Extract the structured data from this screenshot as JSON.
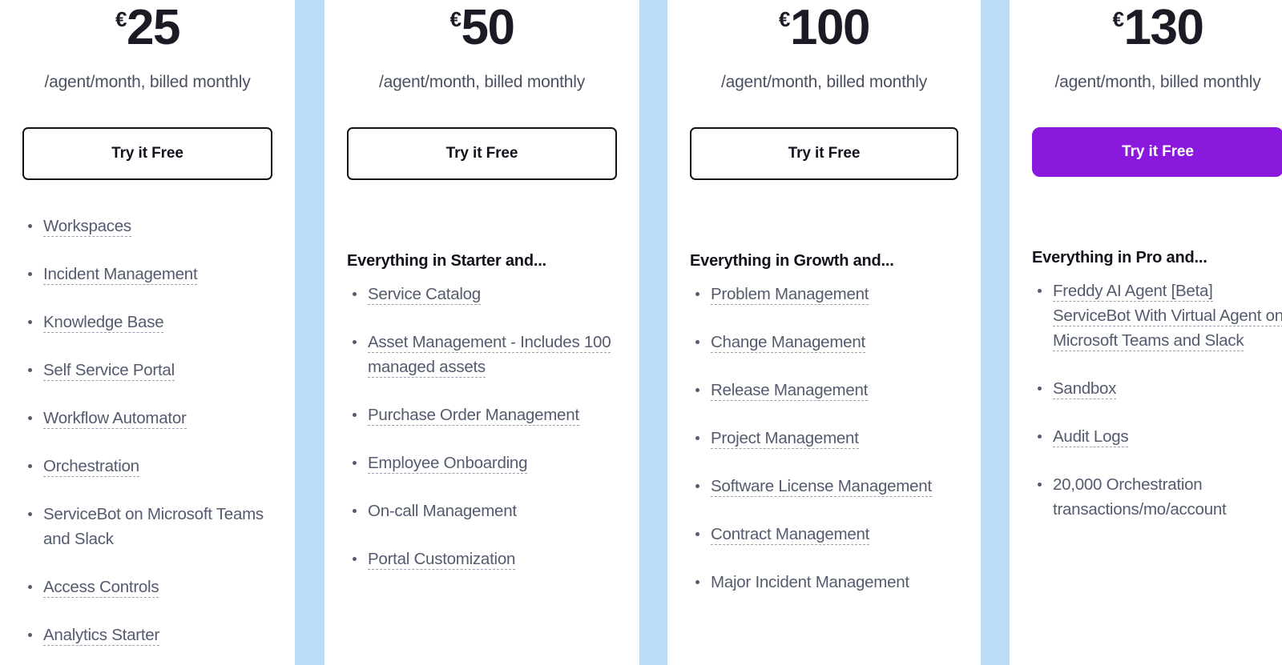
{
  "meta": {
    "accent_purple": "#8b18dd",
    "divider_blue": "#bcdcf5",
    "text_dark": "#12121c",
    "text_muted": "#545b6e"
  },
  "plans": [
    {
      "id": "starter",
      "currency": "€",
      "amount": "25",
      "billing_note": "/agent/month, billed monthly",
      "cta_label": "Try it Free",
      "cta_style": "outline",
      "everything_heading": null,
      "features": [
        {
          "label": "Workspaces",
          "tipped": true
        },
        {
          "label": "Incident Management",
          "tipped": true
        },
        {
          "label": "Knowledge Base",
          "tipped": true
        },
        {
          "label": "Self Service Portal",
          "tipped": true
        },
        {
          "label": "Workflow Automator",
          "tipped": true
        },
        {
          "label": "Orchestration",
          "tipped": true
        },
        {
          "label": "ServiceBot on Microsoft Teams and Slack",
          "tipped": false
        },
        {
          "label": "Access Controls",
          "tipped": true
        },
        {
          "label": "Analytics Starter",
          "tipped": true
        }
      ]
    },
    {
      "id": "growth",
      "currency": "€",
      "amount": "50",
      "billing_note": "/agent/month, billed monthly",
      "cta_label": "Try it Free",
      "cta_style": "outline",
      "everything_heading": "Everything in Starter and...",
      "features": [
        {
          "label": "Service Catalog",
          "tipped": true
        },
        {
          "label": "Asset Management - Includes 100 managed assets",
          "tipped": true
        },
        {
          "label": "Purchase Order Management",
          "tipped": true
        },
        {
          "label": "Employee Onboarding",
          "tipped": true
        },
        {
          "label": "On-call Management",
          "tipped": false
        },
        {
          "label": "Portal Customization",
          "tipped": true
        }
      ]
    },
    {
      "id": "pro",
      "currency": "€",
      "amount": "100",
      "billing_note": "/agent/month, billed monthly",
      "cta_label": "Try it Free",
      "cta_style": "outline",
      "everything_heading": "Everything in Growth and...",
      "features": [
        {
          "label": "Problem Management",
          "tipped": true
        },
        {
          "label": "Change Management",
          "tipped": true
        },
        {
          "label": "Release Management",
          "tipped": true
        },
        {
          "label": "Project Management",
          "tipped": true
        },
        {
          "label": "Software License Management",
          "tipped": true
        },
        {
          "label": "Contract Management",
          "tipped": true
        },
        {
          "label": "Major Incident Management",
          "tipped": false
        }
      ]
    },
    {
      "id": "enterprise",
      "currency": "€",
      "amount": "130",
      "billing_note": "/agent/month, billed monthly",
      "cta_label": "Try it Free",
      "cta_style": "primary",
      "everything_heading": "Everything in Pro and...",
      "features": [
        {
          "label": "Freddy AI Agent [Beta] ServiceBot With Virtual Agent on Microsoft Teams and Slack",
          "tipped": true
        },
        {
          "label": "Sandbox",
          "tipped": true
        },
        {
          "label": "Audit Logs",
          "tipped": true
        },
        {
          "label": "20,000 Orchestration transactions/mo/account",
          "tipped": false
        }
      ]
    }
  ]
}
